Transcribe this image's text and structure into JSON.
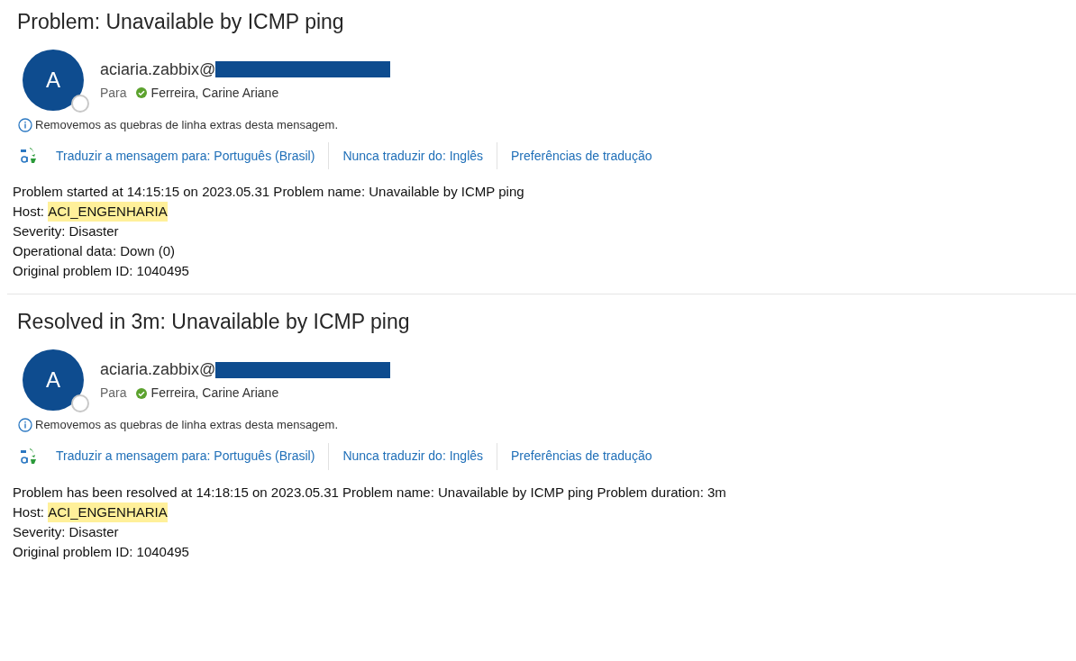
{
  "messages": [
    {
      "subject": "Problem: Unavailable by ICMP ping",
      "avatar_letter": "A",
      "sender": "aciaria.zabbix@",
      "to_label": "Para",
      "recipient": "Ferreira, Carine Ariane",
      "info": "Removemos as quebras de linha extras desta mensagem.",
      "translate_links": [
        "Traduzir a mensagem para: Português (Brasil)",
        "Nunca traduzir do: Inglês",
        "Preferências de tradução"
      ],
      "body": [
        {
          "text": "Problem started at 14:15:15 on 2023.05.31 Problem name: Unavailable by ICMP ping"
        },
        {
          "text": "Host: ",
          "highlight": "ACI_ENGENHARIA"
        },
        {
          "text": "Severity: Disaster"
        },
        {
          "text": "Operational data: Down (0)"
        },
        {
          "text": "Original problem ID: 1040495"
        }
      ]
    },
    {
      "subject": "Resolved in 3m: Unavailable by ICMP ping",
      "avatar_letter": "A",
      "sender": "aciaria.zabbix@",
      "to_label": "Para",
      "recipient": "Ferreira, Carine Ariane",
      "info": "Removemos as quebras de linha extras desta mensagem.",
      "translate_links": [
        "Traduzir a mensagem para: Português (Brasil)",
        "Nunca traduzir do: Inglês",
        "Preferências de tradução"
      ],
      "body": [
        {
          "text": "Problem has been resolved at 14:18:15 on 2023.05.31 Problem name: Unavailable by ICMP ping Problem duration: 3m"
        },
        {
          "text": "Host: ",
          "highlight": "ACI_ENGENHARIA"
        },
        {
          "text": "Severity: Disaster"
        },
        {
          "text": "Original problem ID: 1040495"
        }
      ]
    }
  ]
}
